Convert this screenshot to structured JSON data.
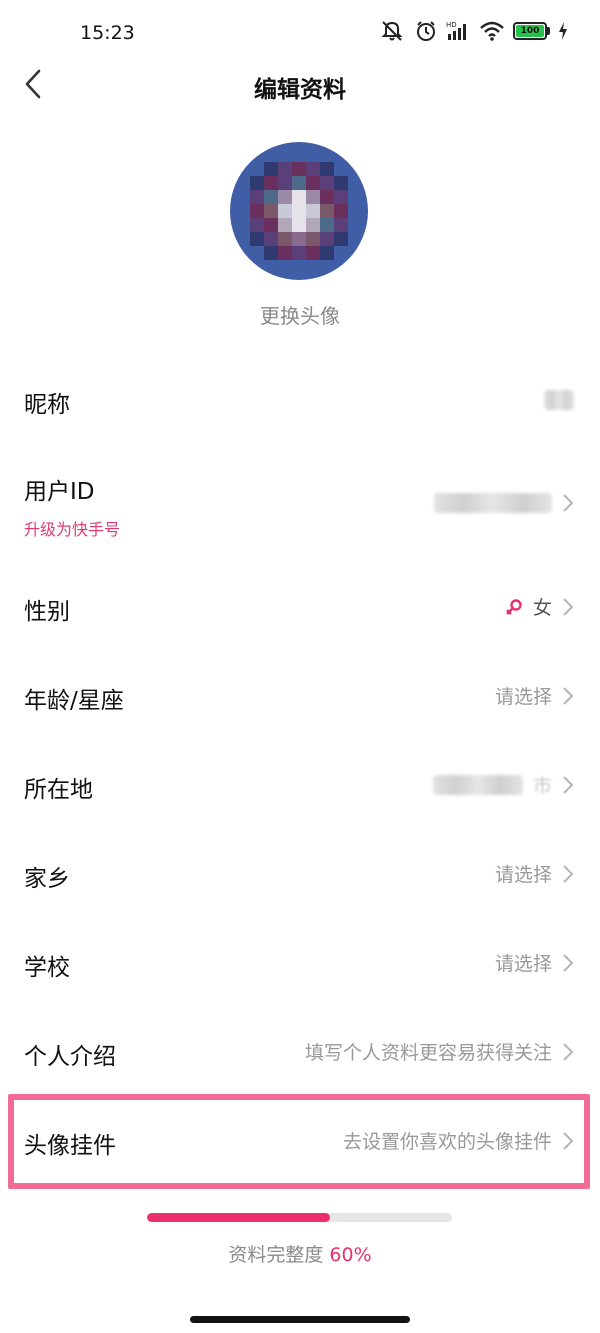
{
  "status_bar": {
    "time": "15:23",
    "battery_level": "100",
    "network_label": "HD",
    "icons": [
      "mute-icon",
      "alarm-icon",
      "hd-signal-icon",
      "wifi-icon",
      "battery-icon",
      "charging-icon"
    ]
  },
  "nav": {
    "title": "编辑资料",
    "back_icon": "chevron-left-icon"
  },
  "profile": {
    "change_avatar_label": "更换头像"
  },
  "rows": {
    "nickname": {
      "label": "昵称"
    },
    "user_id": {
      "label": "用户ID",
      "sub_link": "升级为快手号"
    },
    "gender": {
      "label": "性别",
      "value": "女",
      "icon": "female-icon"
    },
    "age": {
      "label": "年龄/星座",
      "value": "请选择"
    },
    "location": {
      "label": "所在地",
      "value_suffix": "市"
    },
    "hometown": {
      "label": "家乡",
      "value": "请选择"
    },
    "school": {
      "label": "学校",
      "value": "请选择"
    },
    "intro": {
      "label": "个人介绍",
      "value": "填写个人资料更容易获得关注"
    },
    "pendant": {
      "label": "头像挂件",
      "value": "去设置你喜欢的头像挂件"
    }
  },
  "completeness": {
    "label": "资料完整度",
    "percent_text": "60%",
    "fraction": 0.6
  },
  "colors": {
    "accent": "#e8306c",
    "highlight_border": "#f06c95",
    "avatar_bg": "#3f5ea6"
  }
}
